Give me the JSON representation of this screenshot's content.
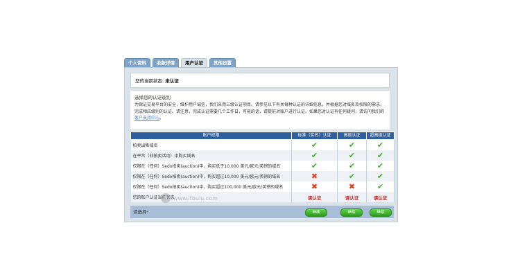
{
  "tabs": [
    {
      "label": "个人资料"
    },
    {
      "label": "收款详情"
    },
    {
      "label": "用户认证"
    },
    {
      "label": "其他设置"
    }
  ],
  "status": {
    "label": "您的当前状态:",
    "value": "未认证"
  },
  "info": {
    "title": "选择您的认证级别",
    "desc": "为保证交易平台的安全，维护用户诚信，我们采用三级认证项目。请参见以下有关每种认证的详细信息，并根据您对域名及权限的需求，完成相应级别的认证。请注意，完成认证需要几个工作日，可能的话，请提前对账户进行认证。如果您对认证有任何疑问，请访问我们的",
    "link": "客户支持中心",
    "tail": "。"
  },
  "table": {
    "headers": [
      "账户权限",
      "标准（实名）认证",
      "高级认证",
      "超高级认证"
    ],
    "rows": [
      {
        "label": "拍卖出售域名",
        "cells": [
          "check",
          "check",
          "check"
        ]
      },
      {
        "label": "在平台（非拍卖活动）中购买域名",
        "cells": [
          "check",
          "check",
          "check"
        ]
      },
      {
        "label": "仅限在（任何）Sedo拍卖(auction)中，购买低于10,000 美元/欧元/英镑的域名",
        "cells": [
          "check",
          "check",
          "check"
        ]
      },
      {
        "label": "仅限在（任何）Sedo拍卖(auction)中，购买超过10,000 美元/欧元/英镑的域名",
        "cells": [
          "cross",
          "check",
          "check"
        ]
      },
      {
        "label": "仅限在（任何）Sedo拍卖(auction)中，购买超过100,000 美元/欧元/英镑的域名",
        "cells": [
          "cross",
          "cross",
          "check"
        ]
      },
      {
        "label": "您的账户认证当前状态",
        "cells": [
          "请认证",
          "请认证",
          "请认证"
        ]
      }
    ]
  },
  "footer": {
    "label": "请选择:",
    "buttons": [
      "继续",
      "继续",
      "继续"
    ]
  },
  "watermark": {
    "text": "www.itbulu.com"
  },
  "icons": {
    "check": "check-icon",
    "cross": "cross-icon"
  }
}
